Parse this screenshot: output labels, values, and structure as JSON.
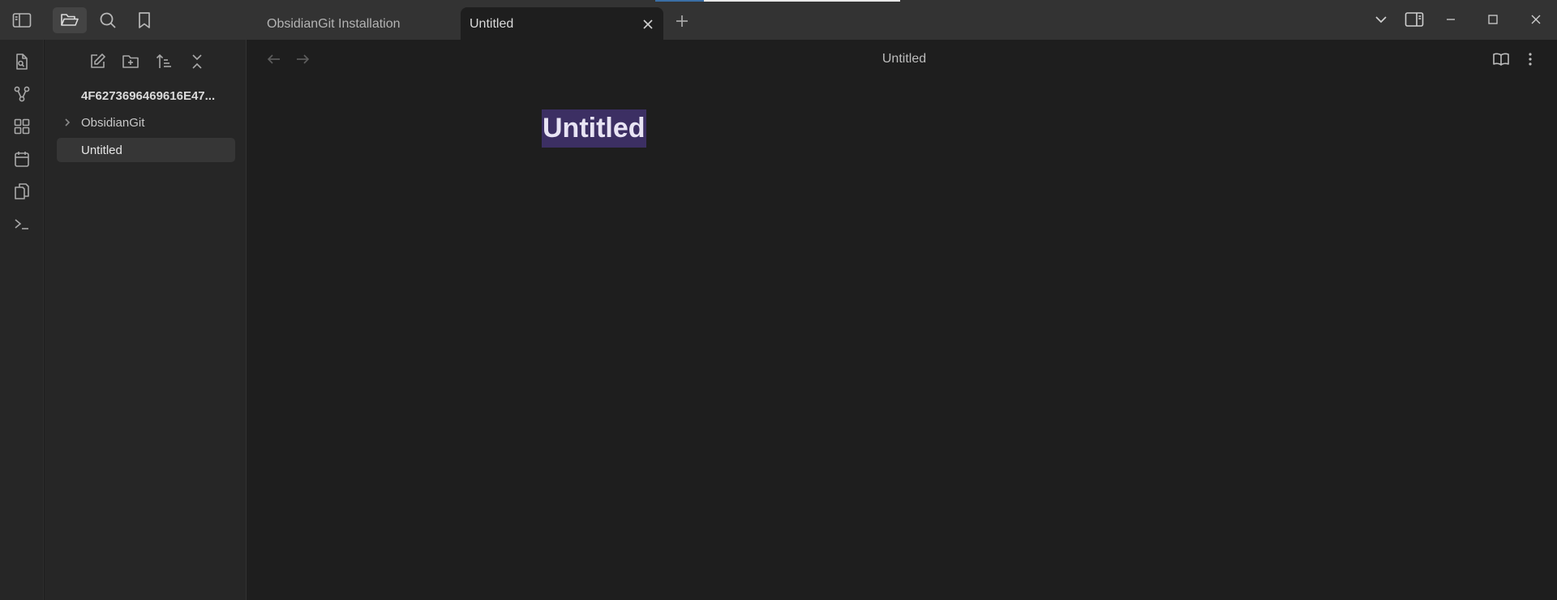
{
  "titlebar": {
    "tabs": [
      {
        "label": "ObsidianGit Installation"
      },
      {
        "label": "Untitled"
      }
    ]
  },
  "sidebar": {
    "vault_name": "4F6273696469616E47...",
    "items": [
      {
        "label": "ObsidianGit"
      },
      {
        "label": "Untitled"
      }
    ]
  },
  "editor": {
    "view_title": "Untitled",
    "inline_title": "Untitled"
  },
  "colors": {
    "accent_selection": "#3c2f63",
    "background": "#1e1e1e",
    "sidebar": "#262626",
    "titlebar": "#333333"
  }
}
